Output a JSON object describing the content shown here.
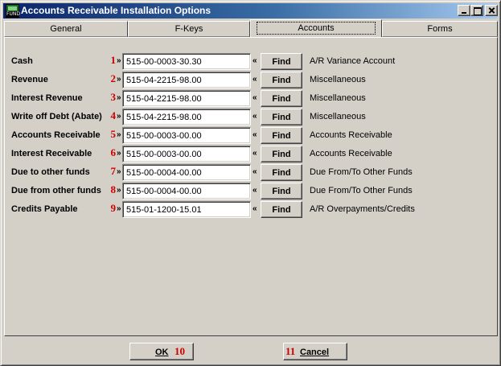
{
  "window": {
    "title": "Accounts Receivable Installation Options",
    "icon_label": "FUND"
  },
  "tabs": [
    {
      "label": "General"
    },
    {
      "label": "F-Keys"
    },
    {
      "label": "Accounts"
    },
    {
      "label": "Forms"
    }
  ],
  "active_tab": "Accounts",
  "rows": [
    {
      "label": "Cash",
      "num": "1",
      "value": "515-00-0003-30.30",
      "find": "Find",
      "desc": "A/R Variance Account"
    },
    {
      "label": "Revenue",
      "num": "2",
      "value": "515-04-2215-98.00",
      "find": "Find",
      "desc": "Miscellaneous"
    },
    {
      "label": "Interest Revenue",
      "num": "3",
      "value": "515-04-2215-98.00",
      "find": "Find",
      "desc": "Miscellaneous"
    },
    {
      "label": "Write off Debt (Abate)",
      "num": "4",
      "value": "515-04-2215-98.00",
      "find": "Find",
      "desc": "Miscellaneous"
    },
    {
      "label": "Accounts Receivable",
      "num": "5",
      "value": "515-00-0003-00.00",
      "find": "Find",
      "desc": "Accounts Receivable"
    },
    {
      "label": "Interest Receivable",
      "num": "6",
      "value": "515-00-0003-00.00",
      "find": "Find",
      "desc": "Accounts Receivable"
    },
    {
      "label": "Due to other funds",
      "num": "7",
      "value": "515-00-0004-00.00",
      "find": "Find",
      "desc": "Due From/To Other Funds"
    },
    {
      "label": "Due from other funds",
      "num": "8",
      "value": "515-00-0004-00.00",
      "find": "Find",
      "desc": "Due From/To Other Funds"
    },
    {
      "label": "Credits Payable",
      "num": "9",
      "value": "515-01-1200-15.01",
      "find": "Find",
      "desc": "A/R Overpayments/Credits"
    }
  ],
  "arrows": {
    "right": "»",
    "left": "«"
  },
  "buttons": {
    "ok_label": "OK",
    "ok_num": "10",
    "cancel_label": "Cancel",
    "cancel_num": "11"
  },
  "colors": {
    "title_bar": "#0a246a",
    "step_number": "#cc0000",
    "face": "#d4d0c8"
  },
  "icons": {
    "minimize": "minimize-icon",
    "maximize": "maximize-icon",
    "close": "close-icon"
  }
}
